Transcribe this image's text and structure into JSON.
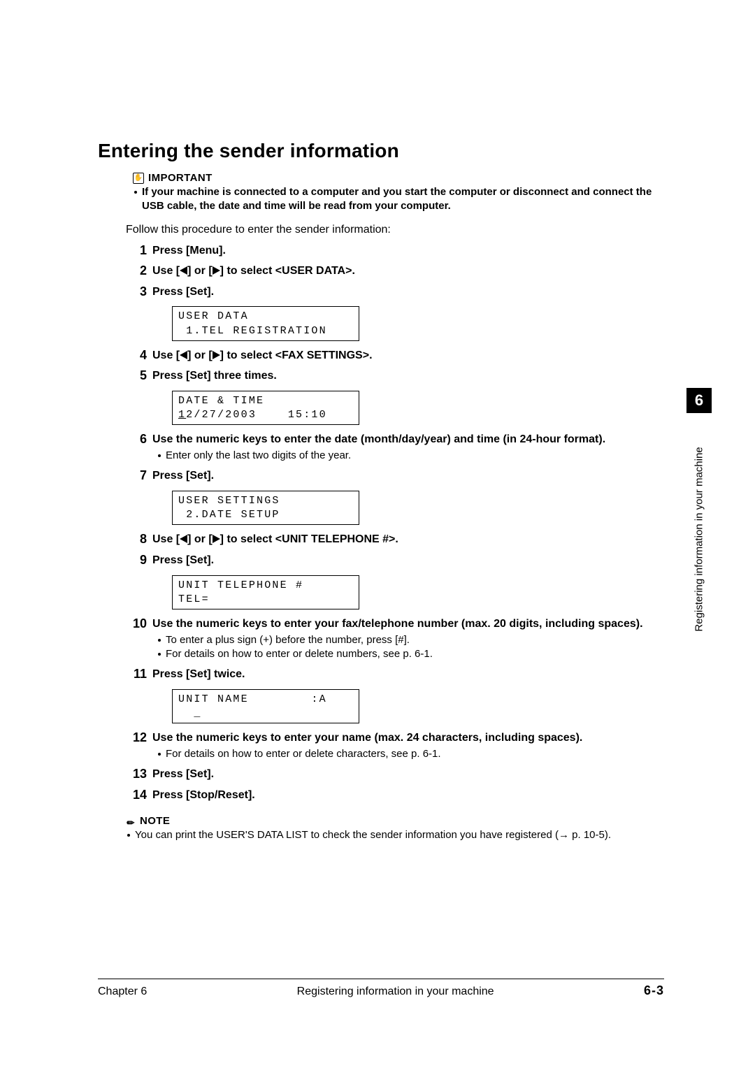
{
  "title": "Entering the sender information",
  "important": {
    "label": "IMPORTANT",
    "text": "If your machine is connected to a computer and you start the computer or disconnect and connect the USB cable, the date and time will be read from your computer."
  },
  "intro": "Follow this procedure to enter the sender information:",
  "steps": [
    {
      "n": "1",
      "title": "Press [Menu]."
    },
    {
      "n": "2",
      "title_pre": "Use [",
      "title_mid": "] or [",
      "title_post": "] to select <USER DATA>.",
      "arrows": true
    },
    {
      "n": "3",
      "title": "Press [Set].",
      "lcd": {
        "line1": "USER DATA",
        "line2_pre": " 1.TEL REGISTRATION"
      }
    },
    {
      "n": "4",
      "title_pre": "Use [",
      "title_mid": "] or [",
      "title_post": "] to select <FAX SETTINGS>.",
      "arrows": true
    },
    {
      "n": "5",
      "title": "Press [Set] three times.",
      "lcd": {
        "line1": "DATE & TIME",
        "line2_u": "1",
        "line2_rest": "2/27/2003    15:10"
      }
    },
    {
      "n": "6",
      "title": "Use the numeric keys to enter the date (month/day/year) and time (in 24-hour format).",
      "subs": [
        "Enter only the last two digits of the year."
      ]
    },
    {
      "n": "7",
      "title": "Press [Set].",
      "lcd": {
        "line1": "USER SETTINGS",
        "line2_pre": " 2.DATE SETUP"
      }
    },
    {
      "n": "8",
      "title_pre": "Use [",
      "title_mid": "] or [",
      "title_post": "] to select <UNIT TELEPHONE #>.",
      "arrows": true
    },
    {
      "n": "9",
      "title": "Press [Set].",
      "lcd": {
        "line1": "UNIT TELEPHONE #",
        "line2_pre": "TEL="
      }
    },
    {
      "n": "10",
      "title": "Use the numeric keys to enter your fax/telephone number (max. 20 digits, including spaces).",
      "subs": [
        "To enter a plus sign (+) before the number, press [#].",
        "For details on how to enter or delete numbers, see p. 6-1."
      ]
    },
    {
      "n": "11",
      "title": "Press [Set] twice.",
      "lcd": {
        "line1": "UNIT NAME        :A",
        "line2_pre": "  _"
      }
    },
    {
      "n": "12",
      "title": "Use the numeric keys to enter your name (max. 24 characters, including spaces).",
      "subs": [
        "For details on how to enter or delete characters, see p. 6-1."
      ]
    },
    {
      "n": "13",
      "title": "Press [Set]."
    },
    {
      "n": "14",
      "title": "Press [Stop/Reset]."
    }
  ],
  "note": {
    "label": "NOTE",
    "text_pre": "You can print the USER'S DATA LIST to check the sender information you have registered (",
    "text_arrow": "→",
    "text_post": " p. 10-5)."
  },
  "footer": {
    "chapter": "Chapter 6",
    "section": "Registering information in your machine",
    "page": "6-3"
  },
  "sidebar": {
    "chapter_num": "6",
    "text": "Registering information in your machine"
  }
}
